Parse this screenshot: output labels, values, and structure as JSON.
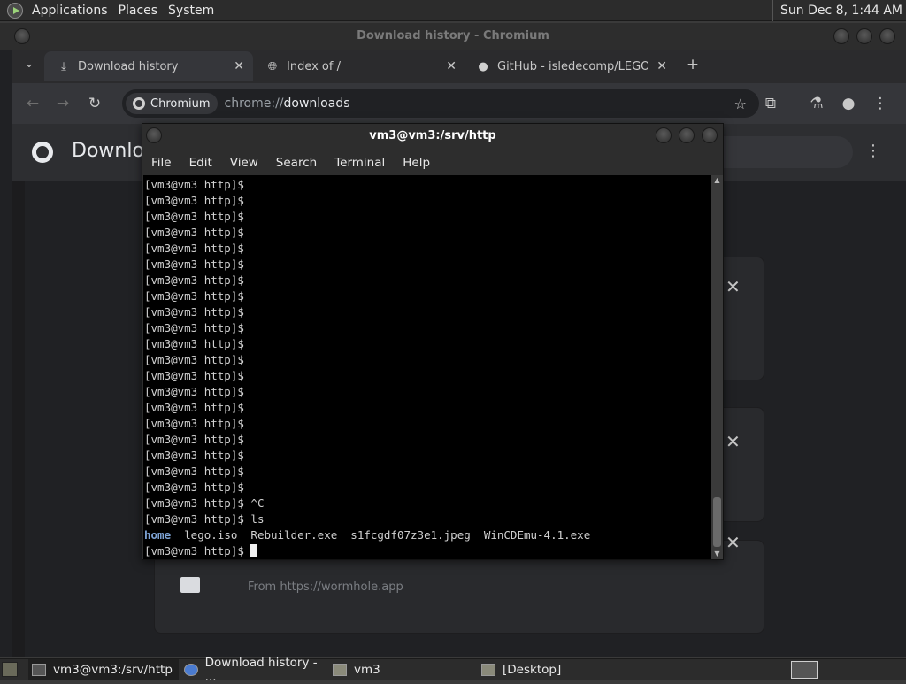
{
  "top_panel": {
    "menus": [
      "Applications",
      "Places",
      "System"
    ],
    "clock": "Sun Dec 8, 1:44 AM"
  },
  "chromium": {
    "window_title": "Download history - Chromium",
    "tabs": [
      {
        "label": "Download history",
        "icon": "download-icon"
      },
      {
        "label": "Index of /",
        "icon": "globe-icon"
      },
      {
        "label": "GitHub - isledecomp/LEGOI",
        "icon": "github-icon"
      }
    ],
    "omnibox": {
      "site_chip": "Chromium",
      "scheme": "chrome://",
      "path": "downloads"
    },
    "page": {
      "title": "Downloa",
      "from_text": "From https://wormhole.app"
    }
  },
  "terminal": {
    "window_title": "vm3@vm3:/srv/http",
    "menus": [
      "File",
      "Edit",
      "View",
      "Search",
      "Terminal",
      "Help"
    ],
    "prompt": "[vm3@vm3 http]$",
    "empty_prompt_lines": 20,
    "lines_after": [
      {
        "prompt": "[vm3@vm3 http]$",
        "cmd": " ^C"
      },
      {
        "prompt": "[vm3@vm3 http]$",
        "cmd": " ls"
      }
    ],
    "ls_output": {
      "dir": "home",
      "files": "  lego.iso  Rebuilder.exe  s1fcgdf07z3e1.jpeg  WinCDEmu-4.1.exe"
    },
    "last_prompt": "[vm3@vm3 http]$ "
  },
  "taskbar": {
    "tasks": [
      {
        "label": "vm3@vm3:/srv/http",
        "icon": "terminal-icon"
      },
      {
        "label": "Download history - ...",
        "icon": "chromium-icon"
      },
      {
        "label": "vm3",
        "icon": "folder-icon"
      },
      {
        "label": "[Desktop]",
        "icon": "folder-icon"
      }
    ]
  },
  "colors": {
    "terminal_bg": "#000000",
    "terminal_fg": "#d0d0d0",
    "ls_dir": "#7ea4d6",
    "chrome_dark": "#202124"
  }
}
